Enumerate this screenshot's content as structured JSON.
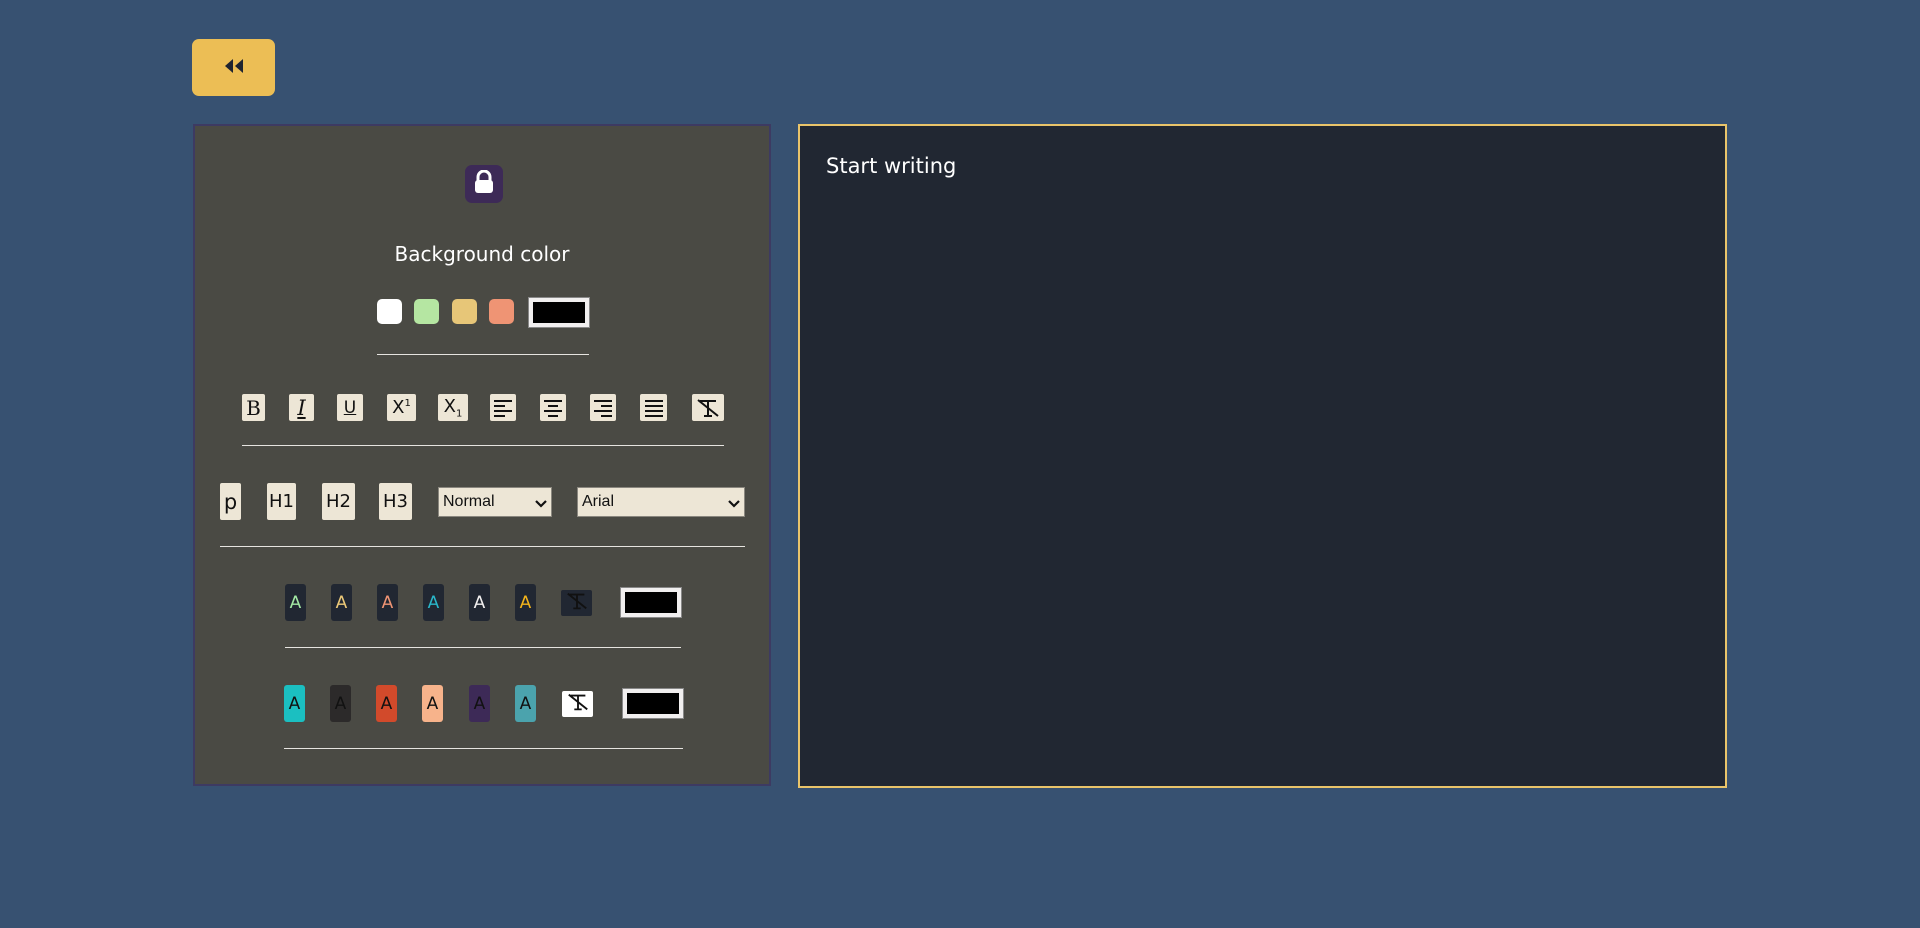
{
  "back_button": {
    "icon": "double-chevron-left-icon"
  },
  "sidebar": {
    "lock_icon": "lock-icon",
    "background_section": {
      "title": "Background color",
      "swatches": [
        "#ffffff",
        "#b5e6a2",
        "#e7c678",
        "#ef9474"
      ],
      "custom_color": "#000000"
    },
    "format_tools": [
      {
        "name": "bold",
        "label": "B"
      },
      {
        "name": "italic",
        "label": "I"
      },
      {
        "name": "underline",
        "label": "U"
      },
      {
        "name": "superscript",
        "label": "X"
      },
      {
        "name": "subscript",
        "label": "X"
      },
      {
        "name": "align-left",
        "icon": "align-left-icon"
      },
      {
        "name": "align-center",
        "icon": "align-center-icon"
      },
      {
        "name": "align-right",
        "icon": "align-right-icon"
      },
      {
        "name": "align-justify",
        "icon": "align-justify-icon"
      },
      {
        "name": "clear-format",
        "icon": "clear-format-icon"
      }
    ],
    "headings": [
      "p",
      "H1",
      "H2",
      "H3"
    ],
    "size_select": {
      "value": "Normal"
    },
    "font_select": {
      "value": "Arial"
    },
    "text_colors": {
      "letter": "A",
      "items": [
        {
          "bg": "#212732",
          "fg": "#a3e9a4"
        },
        {
          "bg": "#212732",
          "fg": "#ecc978"
        },
        {
          "bg": "#212732",
          "fg": "#ef9474"
        },
        {
          "bg": "#212732",
          "fg": "#2ab7ca"
        },
        {
          "bg": "#212732",
          "fg": "#f1efef"
        },
        {
          "bg": "#212732",
          "fg": "#f4b41b"
        }
      ],
      "custom_color": "#000000"
    },
    "highlight_colors": {
      "letter": "A",
      "items": [
        {
          "bg": "#1bbfc1",
          "fg": "#111111"
        },
        {
          "bg": "#2c2a2a",
          "fg": "#111111"
        },
        {
          "bg": "#d24a2b",
          "fg": "#111111"
        },
        {
          "bg": "#f7b38b",
          "fg": "#111111"
        },
        {
          "bg": "#3d2a57",
          "fg": "#111111"
        },
        {
          "bg": "#4ba3ad",
          "fg": "#111111"
        }
      ],
      "custom_color": "#000000"
    }
  },
  "editor": {
    "placeholder": "Start writing"
  }
}
